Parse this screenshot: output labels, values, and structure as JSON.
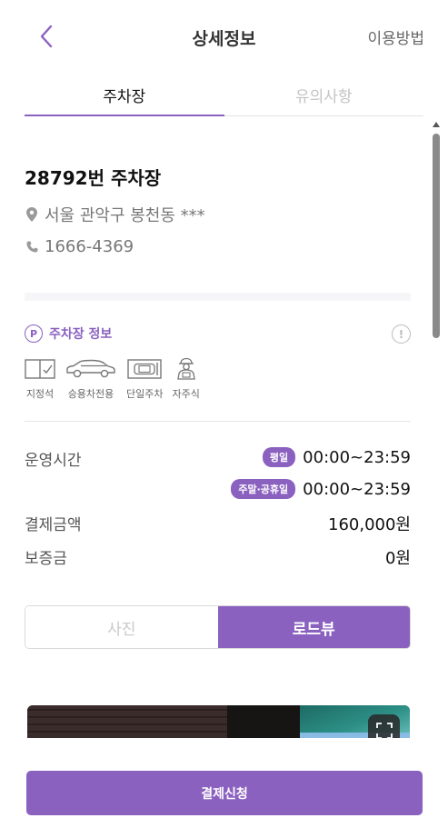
{
  "header": {
    "title": "상세정보",
    "howto_label": "이용방법"
  },
  "tabs": [
    {
      "label": "주차장",
      "active": true
    },
    {
      "label": "유의사항",
      "active": false
    }
  ],
  "lot": {
    "name": "28792번 주차장",
    "address": "서울 관악구 봉천동 ***",
    "phone": "1666-4369"
  },
  "section": {
    "badge": "P",
    "title": "주차장 정보",
    "info_icon": "!"
  },
  "features": [
    {
      "label": "지정석",
      "icon": "reserved-seat-icon"
    },
    {
      "label": "승용차전용",
      "icon": "sedan-car-icon"
    },
    {
      "label": "단일주차",
      "icon": "single-parking-icon"
    },
    {
      "label": "자주식",
      "icon": "self-parking-icon"
    }
  ],
  "details": {
    "hours_label": "운영시간",
    "weekday_badge": "평일",
    "weekday_hours": "00:00~23:59",
    "weekend_badge": "주말·공휴일",
    "weekend_hours": "00:00~23:59",
    "price_label": "결제금액",
    "price_value": "160,000원",
    "deposit_label": "보증금",
    "deposit_value": "0원"
  },
  "segment": {
    "photo_label": "사진",
    "roadview_label": "로드뷰",
    "selected": "로드뷰"
  },
  "footer": {
    "pay_label": "결제신청"
  },
  "colors": {
    "accent": "#8b61c0",
    "muted_text": "#777777",
    "inactive_tab": "#c4c4c4"
  }
}
